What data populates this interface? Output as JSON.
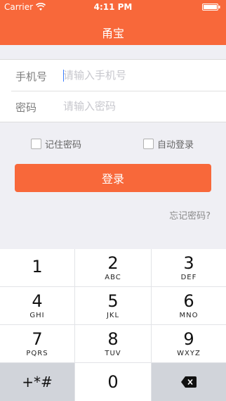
{
  "status_bar": {
    "carrier": "Carrier",
    "time": "4:11 PM"
  },
  "nav": {
    "title": "甬宝"
  },
  "form": {
    "phone_label": "手机号",
    "phone_placeholder": "请输入手机号",
    "password_label": "密码",
    "password_placeholder": "请输入密码"
  },
  "options": {
    "remember_password": "记住密码",
    "auto_login": "自动登录"
  },
  "login_button": "登录",
  "forgot_password": "忘记密码?",
  "keypad": {
    "keys": [
      {
        "num": "1",
        "letters": ""
      },
      {
        "num": "2",
        "letters": "ABC"
      },
      {
        "num": "3",
        "letters": "DEF"
      },
      {
        "num": "4",
        "letters": "GHI"
      },
      {
        "num": "5",
        "letters": "JKL"
      },
      {
        "num": "6",
        "letters": "MNO"
      },
      {
        "num": "7",
        "letters": "PQRS"
      },
      {
        "num": "8",
        "letters": "TUV"
      },
      {
        "num": "9",
        "letters": "WXYZ"
      },
      {
        "num": "+*#",
        "letters": ""
      },
      {
        "num": "0",
        "letters": ""
      }
    ]
  },
  "colors": {
    "accent": "#f8683a",
    "background": "#efeff4",
    "keypad_dark_key": "#d1d4da"
  },
  "icons": {
    "wifi": "wifi-icon",
    "battery": "battery-icon",
    "backspace": "backspace-icon"
  }
}
